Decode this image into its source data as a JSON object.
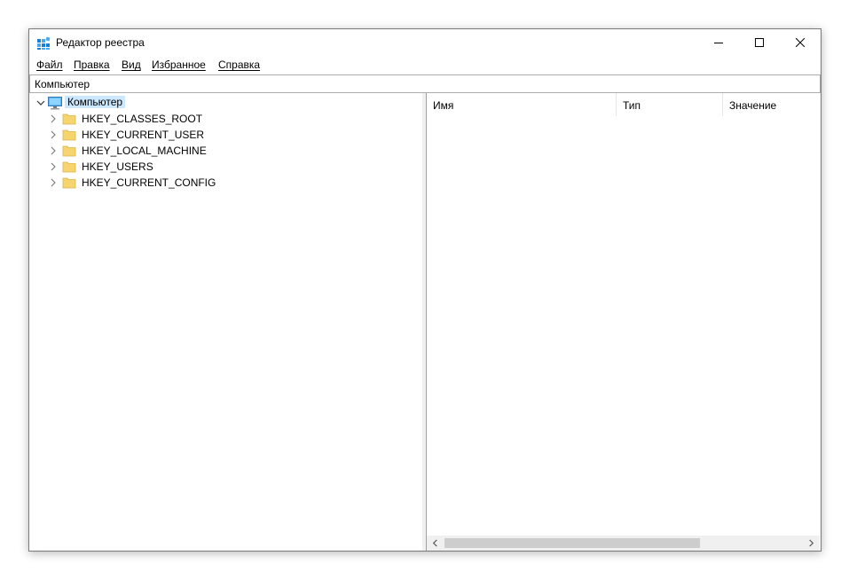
{
  "window": {
    "title": "Редактор реестра"
  },
  "menu": {
    "items": [
      {
        "label": "Файл"
      },
      {
        "label": "Правка"
      },
      {
        "label": "Вид"
      },
      {
        "label": "Избранное"
      },
      {
        "label": "Справка"
      }
    ]
  },
  "address": {
    "path": "Компьютер"
  },
  "tree": {
    "root": {
      "label": "Компьютер",
      "icon": "computer-icon",
      "expanded": true
    },
    "keys": [
      {
        "label": "HKEY_CLASSES_ROOT"
      },
      {
        "label": "HKEY_CURRENT_USER"
      },
      {
        "label": "HKEY_LOCAL_MACHINE"
      },
      {
        "label": "HKEY_USERS"
      },
      {
        "label": "HKEY_CURRENT_CONFIG"
      }
    ]
  },
  "list": {
    "columns": [
      {
        "label": "Имя"
      },
      {
        "label": "Тип"
      },
      {
        "label": "Значение"
      }
    ]
  },
  "colors": {
    "selection": "#cce8ff",
    "folder": "#f7d56e",
    "scroll_track": "#f0f0f0",
    "scroll_thumb": "#cdcdcd"
  }
}
